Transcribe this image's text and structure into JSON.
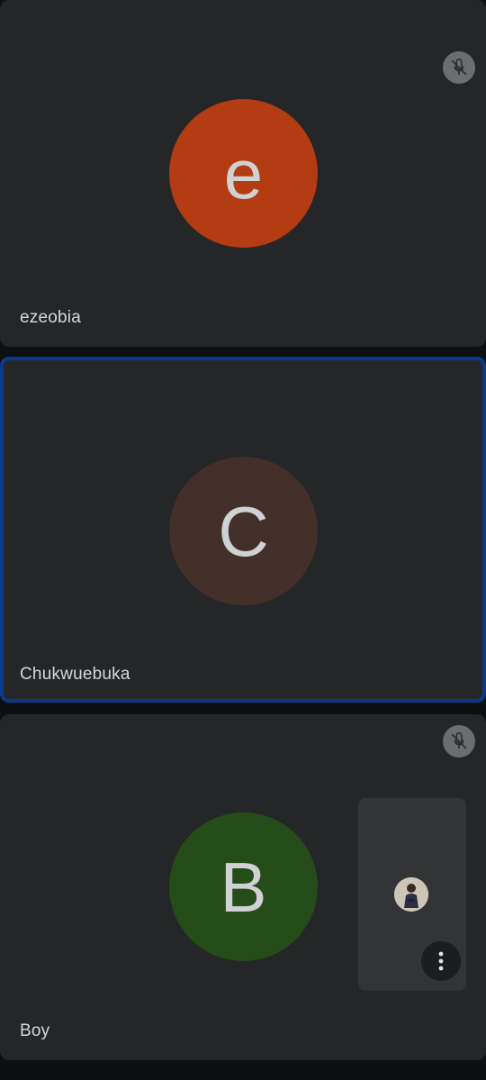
{
  "participants": [
    {
      "name": "ezeobia",
      "initial": "e",
      "avatar_color": "#b33c13",
      "muted": true,
      "active_speaker": false,
      "icon": "mic-off-icon"
    },
    {
      "name": "Chukwuebuka",
      "initial": "C",
      "avatar_color": "#43302a",
      "muted": false,
      "active_speaker": true
    },
    {
      "name": "Boy",
      "initial": "B",
      "avatar_color": "#254d19",
      "muted": true,
      "active_speaker": false,
      "icon": "mic-off-icon"
    }
  ],
  "self_view": {
    "avatar_icon": "user-photo",
    "menu_icon": "more-vert-icon"
  },
  "colors": {
    "background": "#0e0f10",
    "tile": "#252628",
    "active_border": "#0b3a8c",
    "mute_badge": "#6b6d70"
  }
}
